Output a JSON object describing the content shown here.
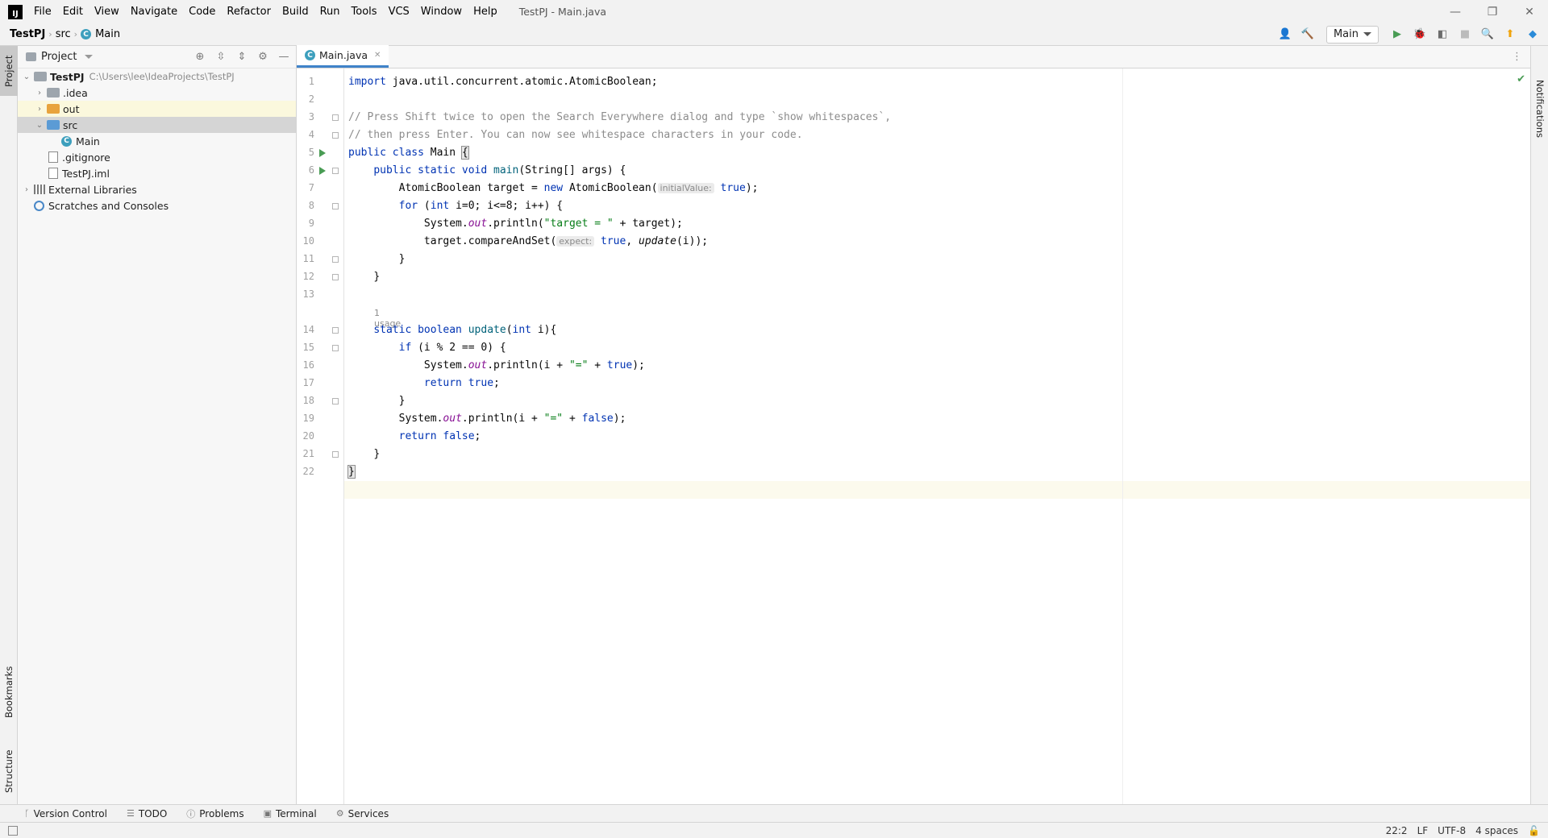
{
  "app": {
    "menu": [
      "File",
      "Edit",
      "View",
      "Navigate",
      "Code",
      "Refactor",
      "Build",
      "Run",
      "Tools",
      "VCS",
      "Window",
      "Help"
    ],
    "window_title": "TestPJ - Main.java"
  },
  "breadcrumb": [
    "TestPJ",
    "src",
    "Main"
  ],
  "toolbar": {
    "run_config": "Main"
  },
  "left_tabs": {
    "project": "Project",
    "bookmarks": "Bookmarks",
    "structure": "Structure"
  },
  "project_panel": {
    "title": "Project",
    "tree": [
      {
        "label": "TestPJ",
        "path": "C:\\Users\\lee\\IdeaProjects\\TestPJ",
        "type": "module",
        "depth": 0,
        "expanded": true
      },
      {
        "label": ".idea",
        "type": "folder-gray",
        "depth": 1,
        "expanded": false
      },
      {
        "label": "out",
        "type": "folder-orange",
        "depth": 1,
        "expanded": false
      },
      {
        "label": "src",
        "type": "folder-blue",
        "depth": 1,
        "expanded": true
      },
      {
        "label": "Main",
        "type": "class",
        "depth": 2
      },
      {
        "label": ".gitignore",
        "type": "file",
        "depth": 1
      },
      {
        "label": "TestPJ.iml",
        "type": "file",
        "depth": 1
      },
      {
        "label": "External Libraries",
        "type": "library",
        "depth": 0,
        "expanded": false
      },
      {
        "label": "Scratches and Consoles",
        "type": "scratch",
        "depth": 0
      }
    ]
  },
  "editor": {
    "tab": "Main.java",
    "line_numbers": [
      "1",
      "2",
      "3",
      "4",
      "5",
      "6",
      "7",
      "8",
      "9",
      "10",
      "11",
      "12",
      "13",
      "14",
      "15",
      "16",
      "17",
      "18",
      "19",
      "20",
      "21",
      "22"
    ],
    "usage_hint": "1 usage",
    "code": {
      "l1_kw": "import",
      "l1": " java.util.concurrent.atomic.AtomicBoolean;",
      "l3": "// Press Shift twice to open the Search Everywhere dialog and type `show whitespaces`,",
      "l4": "// then press Enter. You can now see whitespace characters in your code.",
      "l5_kw": "public class",
      "l5": " Main ",
      "l5_brace": "{",
      "l6_kw": "public static void",
      "l6_m": " main",
      "l6": "(String[] args) {",
      "l7a": "AtomicBoolean target = ",
      "l7_kw": "new",
      "l7b": " AtomicBoolean(",
      "l7_hint": "initialValue:",
      "l7_true": " true",
      "l7c": ");",
      "l8_kw": "for",
      "l8a": " (",
      "l8_kw2": "int",
      "l8b": " i=0; i<=8; i++) {",
      "l9a": "System.",
      "l9_f": "out",
      "l9b": ".println(",
      "l9_s": "\"target = \"",
      "l9c": " + target);",
      "l10a": "target.compareAndSet(",
      "l10_hint": "expect:",
      "l10_true": " true",
      "l10b": ", ",
      "l10_m": "update",
      "l10c": "(i));",
      "l11": "}",
      "l12": "}",
      "l14_kw": "static boolean",
      "l14_m": " update",
      "l14a": "(",
      "l14_kw2": "int",
      "l14b": " i){",
      "l15_kw": "if",
      "l15": " (i % 2 == 0) {",
      "l16a": "System.",
      "l16_f": "out",
      "l16b": ".println(i + ",
      "l16_s": "\"=\"",
      "l16c": " + ",
      "l16_kw": "true",
      "l16d": ");",
      "l17_kw": "return true",
      "l17": ";",
      "l18": "}",
      "l19a": "System.",
      "l19_f": "out",
      "l19b": ".println(i + ",
      "l19_s": "\"=\"",
      "l19c": " + ",
      "l19_kw": "false",
      "l19d": ");",
      "l20_kw": "return false",
      "l20": ";",
      "l21": "}",
      "l22": "}"
    }
  },
  "right_tabs": {
    "notifications": "Notifications"
  },
  "bottom_tools": [
    "Version Control",
    "TODO",
    "Problems",
    "Terminal",
    "Services"
  ],
  "status": {
    "position": "22:2",
    "line_sep": "LF",
    "encoding": "UTF-8",
    "indent": "4 spaces"
  },
  "colors": {
    "keyword": "#0033b3",
    "comment": "#8c8c8c",
    "string": "#067d17",
    "field": "#871094",
    "method": "#00627a",
    "run": "#499c54",
    "accent": "#4083c9"
  }
}
